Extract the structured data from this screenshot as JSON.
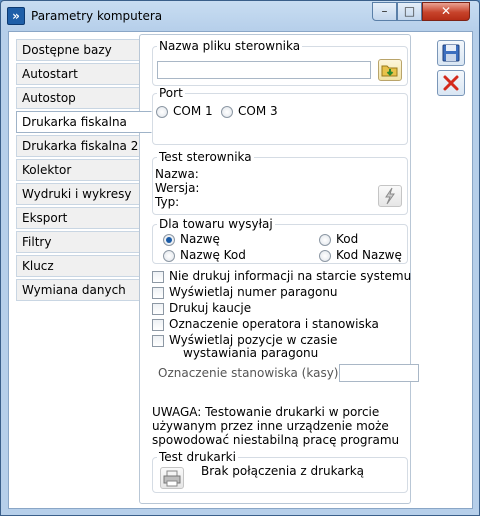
{
  "window": {
    "title": "Parametry komputera"
  },
  "tabs": [
    {
      "label": "Dostępne bazy"
    },
    {
      "label": "Autostart"
    },
    {
      "label": "Autostop"
    },
    {
      "label": "Drukarka fiskalna"
    },
    {
      "label": "Drukarka fiskalna 2"
    },
    {
      "label": "Kolektor"
    },
    {
      "label": "Wydruki i wykresy"
    },
    {
      "label": "Eksport"
    },
    {
      "label": "Filtry"
    },
    {
      "label": "Klucz"
    },
    {
      "label": "Wymiana danych"
    }
  ],
  "active_tab": "Drukarka fiskalna",
  "driver_file": {
    "legend": "Nazwa pliku sterownika",
    "value": ""
  },
  "port": {
    "legend": "Port",
    "options": [
      "COM 1",
      "COM 3"
    ],
    "selected": ""
  },
  "driver_test": {
    "legend": "Test sterownika",
    "name_label": "Nazwa:",
    "version_label": "Wersja:",
    "type_label": "Typ:"
  },
  "send_for_item": {
    "legend": "Dla towaru wysyłaj",
    "options": [
      "Nazwę",
      "Kod",
      "Nazwę Kod",
      "Kod Nazwę"
    ],
    "selected": "Nazwę"
  },
  "checkboxes": [
    {
      "label": "Nie drukuj informacji na starcie systemu",
      "checked": false
    },
    {
      "label": "Wyświetlaj numer paragonu",
      "checked": false
    },
    {
      "label": "Drukuj kaucje",
      "checked": false
    },
    {
      "label": "Oznaczenie operatora i stanowiska",
      "checked": false
    },
    {
      "label": "Wyświetlaj pozycje w czasie",
      "label_line2": "wystawiania paragonu",
      "checked": false
    }
  ],
  "station_mark": {
    "label": "Oznaczenie stanowiska (kasy)",
    "value": ""
  },
  "warning": {
    "line1": "UWAGA: Testowanie drukarki w porcie",
    "line2": "używanym przez inne urządzenie może",
    "line3": "spowodować niestabilną pracę programu"
  },
  "printer_test": {
    "legend": "Test drukarki",
    "status": "Brak połączenia z drukarką"
  },
  "icons": {
    "app": "app-logo-icon",
    "folder": "folder-open-icon",
    "lightning": "lightning-icon",
    "printer": "printer-icon",
    "save": "floppy-disk-icon",
    "cancel": "red-x-icon"
  }
}
